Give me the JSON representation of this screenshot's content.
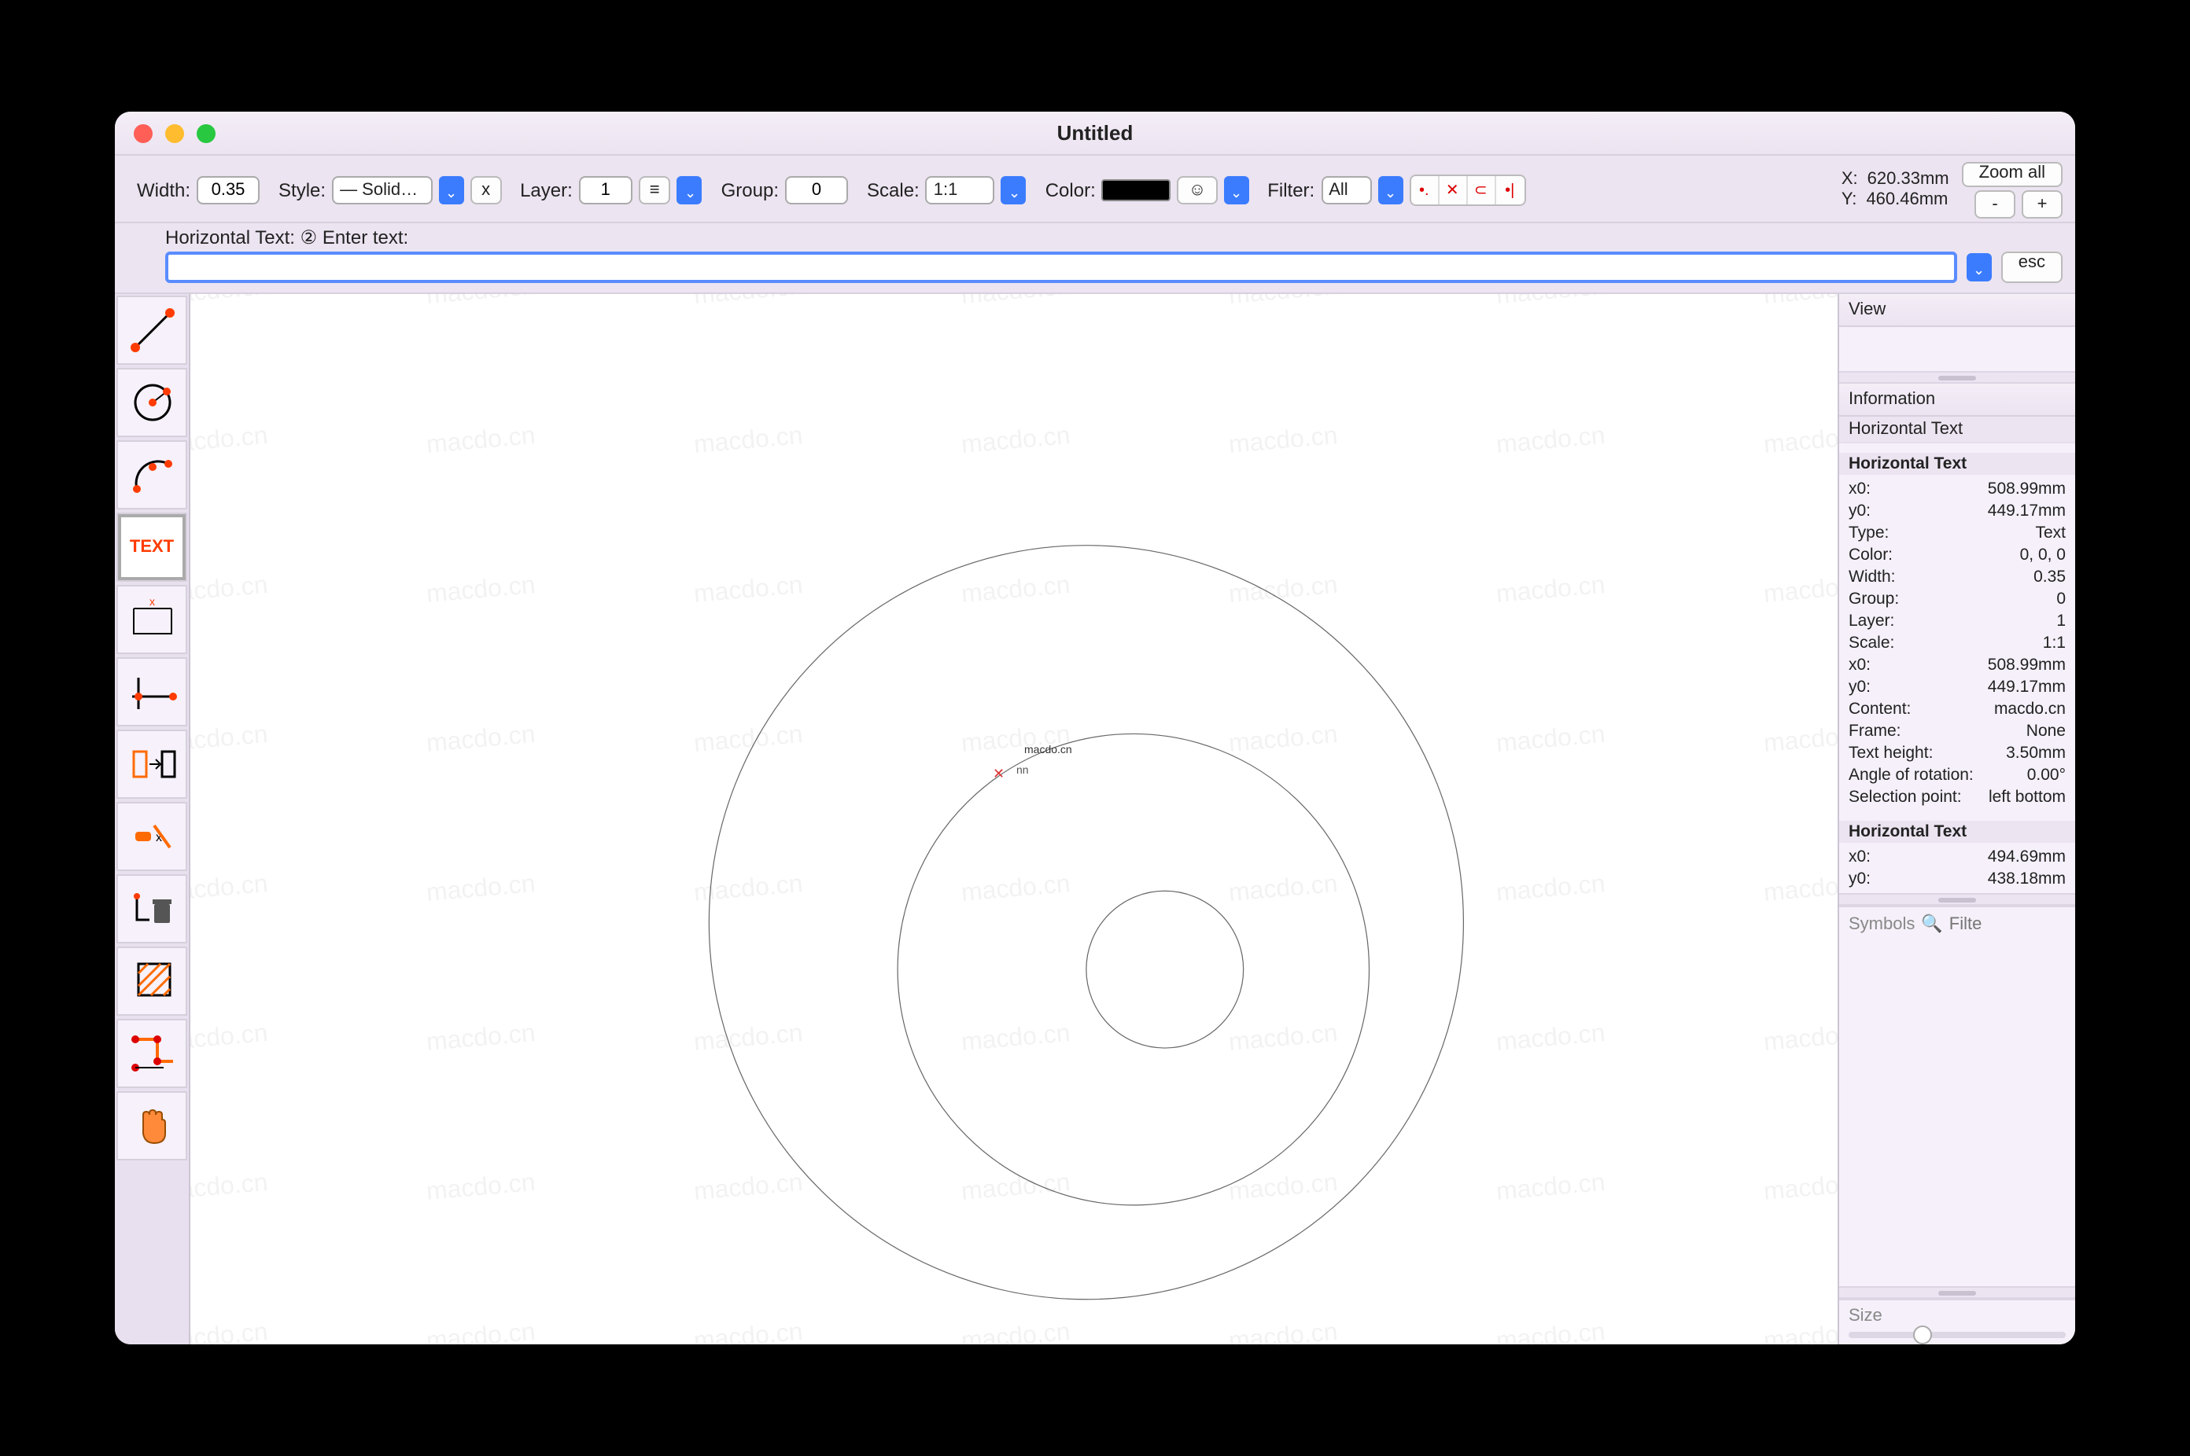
{
  "window": {
    "title": "Untitled"
  },
  "toolbar": {
    "width_label": "Width:",
    "width_value": "0.35",
    "style_label": "Style:",
    "style_value": "— Solid…",
    "style_x": "x",
    "layer_label": "Layer:",
    "layer_value": "1",
    "group_label": "Group:",
    "group_value": "0",
    "scale_label": "Scale:",
    "scale_value": "1:1",
    "color_label": "Color:",
    "filter_label": "Filter:",
    "filter_value": "All",
    "coord_x_label": "X:",
    "coord_y_label": "Y:",
    "coord_x": "620.33mm",
    "coord_y": "460.46mm",
    "zoom_all": "Zoom all",
    "zoom_minus": "-",
    "zoom_plus": "+"
  },
  "ht": {
    "prompt": "Horizontal Text: ② Enter text:",
    "value": "",
    "esc": "esc"
  },
  "tools": {
    "text_label": "TEXT"
  },
  "canvas": {
    "text_sample": "macdo.cn",
    "cursor_mark": "✕",
    "nn": "nn",
    "watermark": "macdo.cn"
  },
  "right": {
    "view": "View",
    "information": "Information",
    "obj_type_head": "Horizontal Text",
    "section1_title": "Horizontal Text",
    "section1": [
      [
        "x0:",
        "508.99mm"
      ],
      [
        "y0:",
        "449.17mm"
      ],
      [
        "Type:",
        "Text"
      ],
      [
        "Color:",
        "0, 0, 0"
      ],
      [
        "Width:",
        "0.35"
      ],
      [
        "Group:",
        "0"
      ],
      [
        "Layer:",
        "1"
      ],
      [
        "Scale:",
        "1:1"
      ],
      [
        "x0:",
        "508.99mm"
      ],
      [
        "y0:",
        "449.17mm"
      ],
      [
        "Content:",
        "macdo.cn"
      ],
      [
        "Frame:",
        "None"
      ],
      [
        "Text height:",
        "3.50mm"
      ],
      [
        "Angle of rotation:",
        "0.00°"
      ],
      [
        "Selection point:",
        "left bottom"
      ]
    ],
    "section2_title": "Horizontal Text",
    "section2": [
      [
        "x0:",
        "494.69mm"
      ],
      [
        "y0:",
        "438.18mm"
      ]
    ],
    "symbols_label": "Symbols",
    "symbols_placeholder": "Filte",
    "size_label": "Size"
  }
}
